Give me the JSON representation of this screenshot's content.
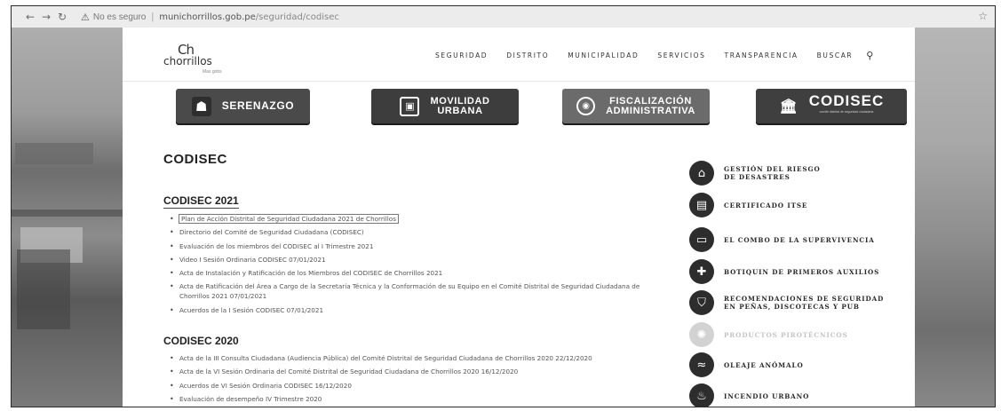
{
  "browser": {
    "not_secure": "No es seguro",
    "url_host": "munichorrillos.gob.pe",
    "url_path": "/seguridad/codisec"
  },
  "header": {
    "logo_mark": "Ch",
    "logo_text": "chorrillos",
    "logo_sub": "Mas gobs",
    "nav": [
      "SEGURIDAD",
      "DISTRITO",
      "MUNICIPALIDAD",
      "SERVICIOS",
      "TRANSPARENCIA",
      "BUSCAR"
    ]
  },
  "banners": {
    "serenazgo": "SERENAZGO",
    "movilidad_1": "MOVILIDAD",
    "movilidad_2": "URBANA",
    "fiscal_1": "FISCALIZACIÓN",
    "fiscal_2": "ADMINISTRATIVA",
    "codisec": "CODISEC",
    "codisec_sub": "comité distrital de seguridad ciudadana"
  },
  "main": {
    "title": "CODISEC",
    "section_2021": "CODISEC 2021",
    "links_2021": [
      "Plan de Acción Distrital de Seguridad Ciudadana 2021 de Chorrillos",
      "Directorio del Comité de Seguridad Ciudadana (CODISEC)",
      "Evaluación de los miembros del CODISEC al I Trimestre 2021",
      "Video I Sesión Ordinaria CODISEC 07/01/2021",
      "Acta de Instalación y Ratificación de los Miembros del CODISEC de Chorrillos 2021",
      "Acta de Ratificación del Área a Cargo de la Secretaría Técnica y la Conformación de su Equipo en el Comité Distrital de Seguridad Ciudadana de Chorrillos 2021 07/01/2021",
      "Acuerdos de la I Sesión CODISEC 07/01/2021"
    ],
    "section_2020": "CODISEC 2020",
    "links_2020": [
      "Acta de la III Consulta Ciudadana (Audiencia Pública) del Comité Distrital de Seguridad Ciudadana de Chorrillos 2020 22/12/2020",
      "Acta de la VI Sesión Ordinaria del Comité Distrital de Seguridad Ciudadana de Chorrillos 2020 16/12/2020",
      "Acuerdos de VI Sesión Ordinaria CODISEC 16/12/2020",
      "Evaluación de desempeño IV Trimestre 2020"
    ]
  },
  "sidebar": {
    "items": [
      {
        "label_1": "GESTIÓN DEL RIESGO",
        "label_2": "DE DESASTRES",
        "icon": "risk-icon"
      },
      {
        "label_1": "CERTIFICADO ITSE",
        "label_2": "",
        "icon": "certificate-icon"
      },
      {
        "label_1": "EL COMBO DE LA SUPERVIVENCIA",
        "label_2": "",
        "icon": "survival-kit-icon"
      },
      {
        "label_1": "BOTIQUIN DE PRIMEROS AUXILIOS",
        "label_2": "",
        "icon": "first-aid-icon"
      },
      {
        "label_1": "RECOMENDACIONES DE SEGURIDAD",
        "label_2": "EN PEÑAS, DISCOTECAS Y PUB",
        "icon": "shield-icon"
      },
      {
        "label_1": "PRODUCTOS PIROTÉCNICOS",
        "label_2": "",
        "icon": "fireworks-icon"
      },
      {
        "label_1": "OLEAJE ANÓMALO",
        "label_2": "",
        "icon": "wave-icon"
      },
      {
        "label_1": "INCENDIO URBANO",
        "label_2": "",
        "icon": "fire-icon"
      }
    ]
  }
}
